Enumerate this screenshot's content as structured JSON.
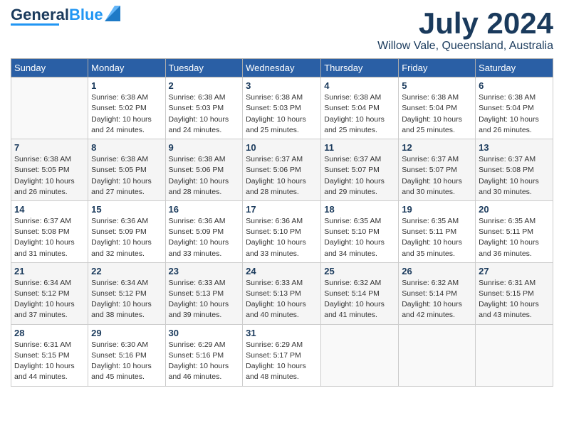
{
  "header": {
    "logo_line1": "General",
    "logo_line2": "Blue",
    "month": "July 2024",
    "location": "Willow Vale, Queensland, Australia"
  },
  "weekdays": [
    "Sunday",
    "Monday",
    "Tuesday",
    "Wednesday",
    "Thursday",
    "Friday",
    "Saturday"
  ],
  "weeks": [
    [
      {
        "day": "",
        "info": ""
      },
      {
        "day": "1",
        "info": "Sunrise: 6:38 AM\nSunset: 5:02 PM\nDaylight: 10 hours\nand 24 minutes."
      },
      {
        "day": "2",
        "info": "Sunrise: 6:38 AM\nSunset: 5:03 PM\nDaylight: 10 hours\nand 24 minutes."
      },
      {
        "day": "3",
        "info": "Sunrise: 6:38 AM\nSunset: 5:03 PM\nDaylight: 10 hours\nand 25 minutes."
      },
      {
        "day": "4",
        "info": "Sunrise: 6:38 AM\nSunset: 5:04 PM\nDaylight: 10 hours\nand 25 minutes."
      },
      {
        "day": "5",
        "info": "Sunrise: 6:38 AM\nSunset: 5:04 PM\nDaylight: 10 hours\nand 25 minutes."
      },
      {
        "day": "6",
        "info": "Sunrise: 6:38 AM\nSunset: 5:04 PM\nDaylight: 10 hours\nand 26 minutes."
      }
    ],
    [
      {
        "day": "7",
        "info": "Sunrise: 6:38 AM\nSunset: 5:05 PM\nDaylight: 10 hours\nand 26 minutes."
      },
      {
        "day": "8",
        "info": "Sunrise: 6:38 AM\nSunset: 5:05 PM\nDaylight: 10 hours\nand 27 minutes."
      },
      {
        "day": "9",
        "info": "Sunrise: 6:38 AM\nSunset: 5:06 PM\nDaylight: 10 hours\nand 28 minutes."
      },
      {
        "day": "10",
        "info": "Sunrise: 6:37 AM\nSunset: 5:06 PM\nDaylight: 10 hours\nand 28 minutes."
      },
      {
        "day": "11",
        "info": "Sunrise: 6:37 AM\nSunset: 5:07 PM\nDaylight: 10 hours\nand 29 minutes."
      },
      {
        "day": "12",
        "info": "Sunrise: 6:37 AM\nSunset: 5:07 PM\nDaylight: 10 hours\nand 30 minutes."
      },
      {
        "day": "13",
        "info": "Sunrise: 6:37 AM\nSunset: 5:08 PM\nDaylight: 10 hours\nand 30 minutes."
      }
    ],
    [
      {
        "day": "14",
        "info": "Sunrise: 6:37 AM\nSunset: 5:08 PM\nDaylight: 10 hours\nand 31 minutes."
      },
      {
        "day": "15",
        "info": "Sunrise: 6:36 AM\nSunset: 5:09 PM\nDaylight: 10 hours\nand 32 minutes."
      },
      {
        "day": "16",
        "info": "Sunrise: 6:36 AM\nSunset: 5:09 PM\nDaylight: 10 hours\nand 33 minutes."
      },
      {
        "day": "17",
        "info": "Sunrise: 6:36 AM\nSunset: 5:10 PM\nDaylight: 10 hours\nand 33 minutes."
      },
      {
        "day": "18",
        "info": "Sunrise: 6:35 AM\nSunset: 5:10 PM\nDaylight: 10 hours\nand 34 minutes."
      },
      {
        "day": "19",
        "info": "Sunrise: 6:35 AM\nSunset: 5:11 PM\nDaylight: 10 hours\nand 35 minutes."
      },
      {
        "day": "20",
        "info": "Sunrise: 6:35 AM\nSunset: 5:11 PM\nDaylight: 10 hours\nand 36 minutes."
      }
    ],
    [
      {
        "day": "21",
        "info": "Sunrise: 6:34 AM\nSunset: 5:12 PM\nDaylight: 10 hours\nand 37 minutes."
      },
      {
        "day": "22",
        "info": "Sunrise: 6:34 AM\nSunset: 5:12 PM\nDaylight: 10 hours\nand 38 minutes."
      },
      {
        "day": "23",
        "info": "Sunrise: 6:33 AM\nSunset: 5:13 PM\nDaylight: 10 hours\nand 39 minutes."
      },
      {
        "day": "24",
        "info": "Sunrise: 6:33 AM\nSunset: 5:13 PM\nDaylight: 10 hours\nand 40 minutes."
      },
      {
        "day": "25",
        "info": "Sunrise: 6:32 AM\nSunset: 5:14 PM\nDaylight: 10 hours\nand 41 minutes."
      },
      {
        "day": "26",
        "info": "Sunrise: 6:32 AM\nSunset: 5:14 PM\nDaylight: 10 hours\nand 42 minutes."
      },
      {
        "day": "27",
        "info": "Sunrise: 6:31 AM\nSunset: 5:15 PM\nDaylight: 10 hours\nand 43 minutes."
      }
    ],
    [
      {
        "day": "28",
        "info": "Sunrise: 6:31 AM\nSunset: 5:15 PM\nDaylight: 10 hours\nand 44 minutes."
      },
      {
        "day": "29",
        "info": "Sunrise: 6:30 AM\nSunset: 5:16 PM\nDaylight: 10 hours\nand 45 minutes."
      },
      {
        "day": "30",
        "info": "Sunrise: 6:29 AM\nSunset: 5:16 PM\nDaylight: 10 hours\nand 46 minutes."
      },
      {
        "day": "31",
        "info": "Sunrise: 6:29 AM\nSunset: 5:17 PM\nDaylight: 10 hours\nand 48 minutes."
      },
      {
        "day": "",
        "info": ""
      },
      {
        "day": "",
        "info": ""
      },
      {
        "day": "",
        "info": ""
      }
    ]
  ]
}
